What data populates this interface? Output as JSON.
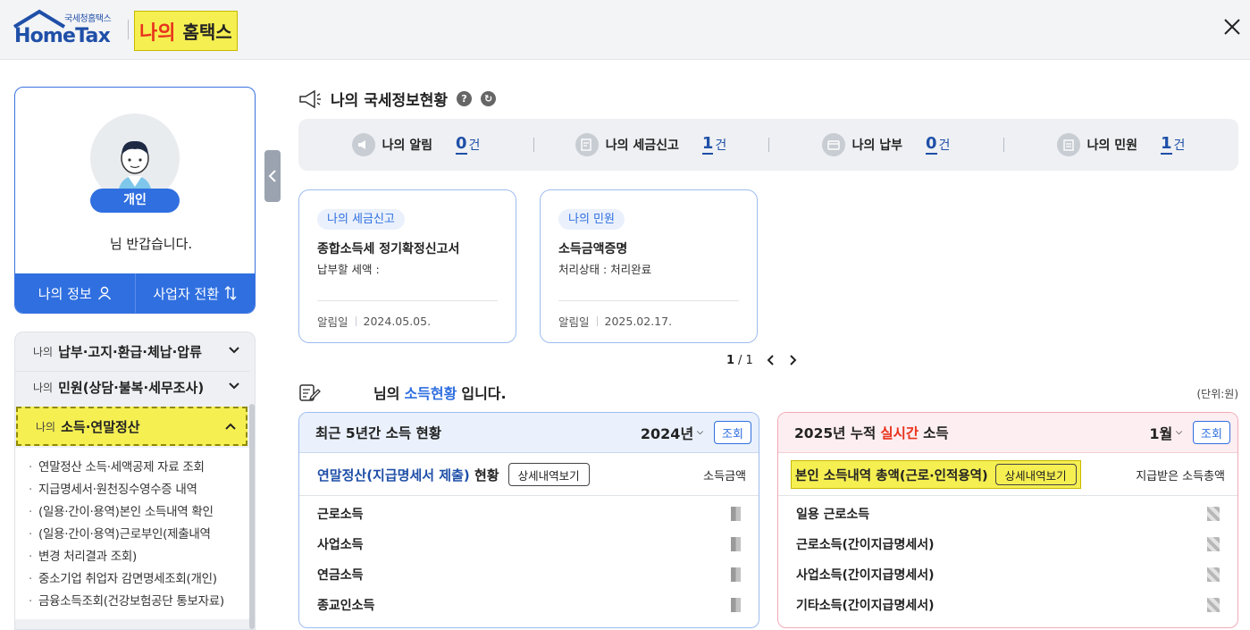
{
  "header": {
    "logo_sub": "국세청홈택스",
    "logo_main": "HomeTax",
    "my_na": "나의",
    "my_rest": "홈택스"
  },
  "profile": {
    "badge": "개인",
    "greeting": "님 반갑습니다.",
    "my_info": "나의 정보",
    "switch_business": "사업자 전환"
  },
  "menu": {
    "items": [
      {
        "pre": "나의",
        "label": "납부·고지·환급·체납·압류"
      },
      {
        "pre": "나의",
        "label": "민원(상담·불복·세무조사)"
      },
      {
        "pre": "나의",
        "label": "소득·연말정산"
      }
    ],
    "sub_items": [
      "연말정산 소득·세액공제 자료 조회",
      "지급명세서·원천징수영수증 내역",
      "(일용·간이·용역)본인 소득내역 확인",
      "(일용·간이·용역)근로부인(제출내역",
      "변경 처리결과 조회)",
      "중소기업 취업자 감면명세조회(개인)",
      "금융소득조회(건강보험공단 통보자료)"
    ]
  },
  "status": {
    "title": "나의 국세정보현황",
    "items": [
      {
        "label": "나의 알림",
        "count": "0",
        "unit": "건"
      },
      {
        "label": "나의 세금신고",
        "count": "1",
        "unit": "건"
      },
      {
        "label": "나의 납부",
        "count": "0",
        "unit": "건"
      },
      {
        "label": "나의 민원",
        "count": "1",
        "unit": "건"
      }
    ]
  },
  "notices": [
    {
      "tag": "나의 세금신고",
      "title": "종합소득세 정기확정신고서",
      "sub": "납부할 세액 :",
      "date_label": "알림일",
      "date": "2024.05.05."
    },
    {
      "tag": "나의 민원",
      "title": "소득금액증명",
      "sub": "처리상태 : 처리완료",
      "date_label": "알림일",
      "date": "2025.02.17."
    }
  ],
  "pager": {
    "current": "1",
    "total": "/ 1"
  },
  "income": {
    "title_pre": "님의",
    "title_hl": "소득현황",
    "title_post": "입니다.",
    "unit_note": "(단위:원)",
    "left": {
      "head": "최근 5년간 소득 현황",
      "year": "2024년",
      "query": "조회",
      "sub_title_blue": "연말정산(지급명세서 제출)",
      "sub_title_black": "현황",
      "detail": "상세내역보기",
      "col": "소득금액",
      "rows": [
        "근로소득",
        "사업소득",
        "연금소득",
        "종교인소득"
      ]
    },
    "right": {
      "head_pre": "2025년 누적",
      "head_red": "실시간",
      "head_post": "소득",
      "month": "1월",
      "query": "조회",
      "sub_title": "본인 소득내역 총액(근로·인적용역)",
      "detail": "상세내역보기",
      "col": "지급받은 소득총액",
      "rows": [
        "일용 근로소득",
        "근로소득(간이지급명세서)",
        "사업소득(간이지급명세서)",
        "기타소득(간이지급명세서)"
      ]
    }
  }
}
